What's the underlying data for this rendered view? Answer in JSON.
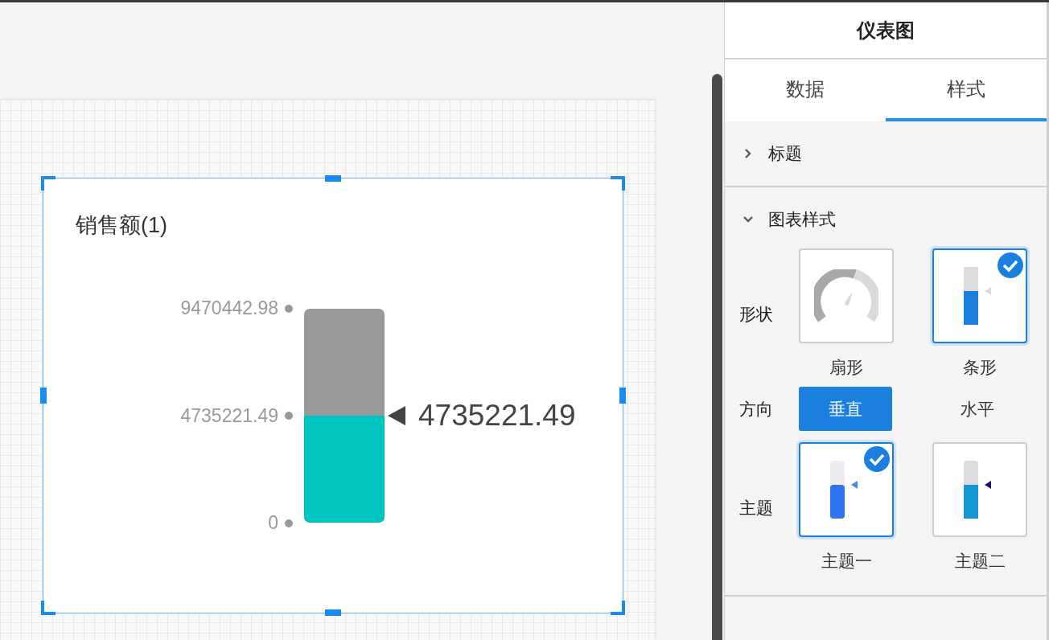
{
  "canvas": {
    "chart_card": {
      "title": "销售额(1)",
      "ticks": [
        "9470442.98",
        "4735221.49",
        "0"
      ],
      "value": "4735221.49",
      "level": 0.5
    }
  },
  "panel": {
    "title": "仪表图",
    "tabs": [
      {
        "label": "数据",
        "selected": false
      },
      {
        "label": "样式",
        "selected": true
      }
    ],
    "sections": [
      {
        "title": "标题",
        "expanded": false
      },
      {
        "title": "图表样式",
        "expanded": true,
        "shape": {
          "label": "形状",
          "options": [
            {
              "kind": "gauge",
              "label": "扇形",
              "selected": false
            },
            {
              "kind": "bar",
              "label": "条形",
              "selected": true
            }
          ]
        },
        "direction": {
          "label": "方向",
          "options": [
            {
              "label": "垂直",
              "selected": true
            },
            {
              "label": "水平",
              "selected": false
            }
          ]
        },
        "theme": {
          "label": "主题",
          "options": [
            {
              "kind": "theme-one",
              "label": "主题一",
              "selected": true
            },
            {
              "kind": "theme-two",
              "label": "主题二",
              "selected": false
            }
          ]
        }
      }
    ]
  }
}
